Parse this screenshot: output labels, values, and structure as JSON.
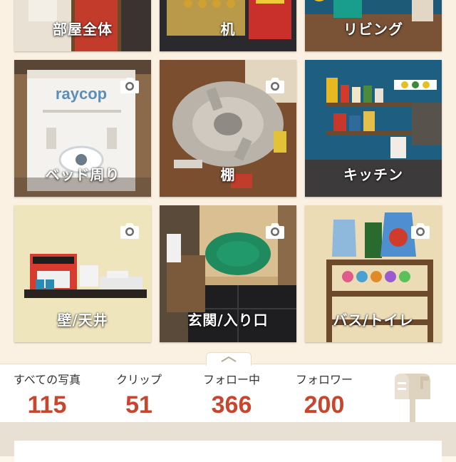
{
  "rooms": [
    {
      "label": "部屋全体",
      "icon": "camera-icon"
    },
    {
      "label": "机",
      "icon": "camera-icon"
    },
    {
      "label": "リビング",
      "icon": "camera-icon"
    },
    {
      "label": "ベッド周り",
      "icon": "camera-icon"
    },
    {
      "label": "棚",
      "icon": "camera-icon"
    },
    {
      "label": "キッチン",
      "icon": "camera-icon"
    },
    {
      "label": "壁/天井",
      "icon": "camera-icon"
    },
    {
      "label": "玄関/入り口",
      "icon": "camera-icon"
    },
    {
      "label": "バス/トイレ",
      "icon": "camera-icon"
    }
  ],
  "stats": {
    "all_photos": {
      "label": "すべての写真",
      "value": "115"
    },
    "clips": {
      "label": "クリップ",
      "value": "51"
    },
    "following": {
      "label": "フォロー中",
      "value": "366"
    },
    "followers": {
      "label": "フォロワー",
      "value": "200"
    }
  },
  "colors": {
    "stat_value": "#c8462e",
    "background": "#fbf1e2",
    "mailbox": "#ddd3bf"
  }
}
